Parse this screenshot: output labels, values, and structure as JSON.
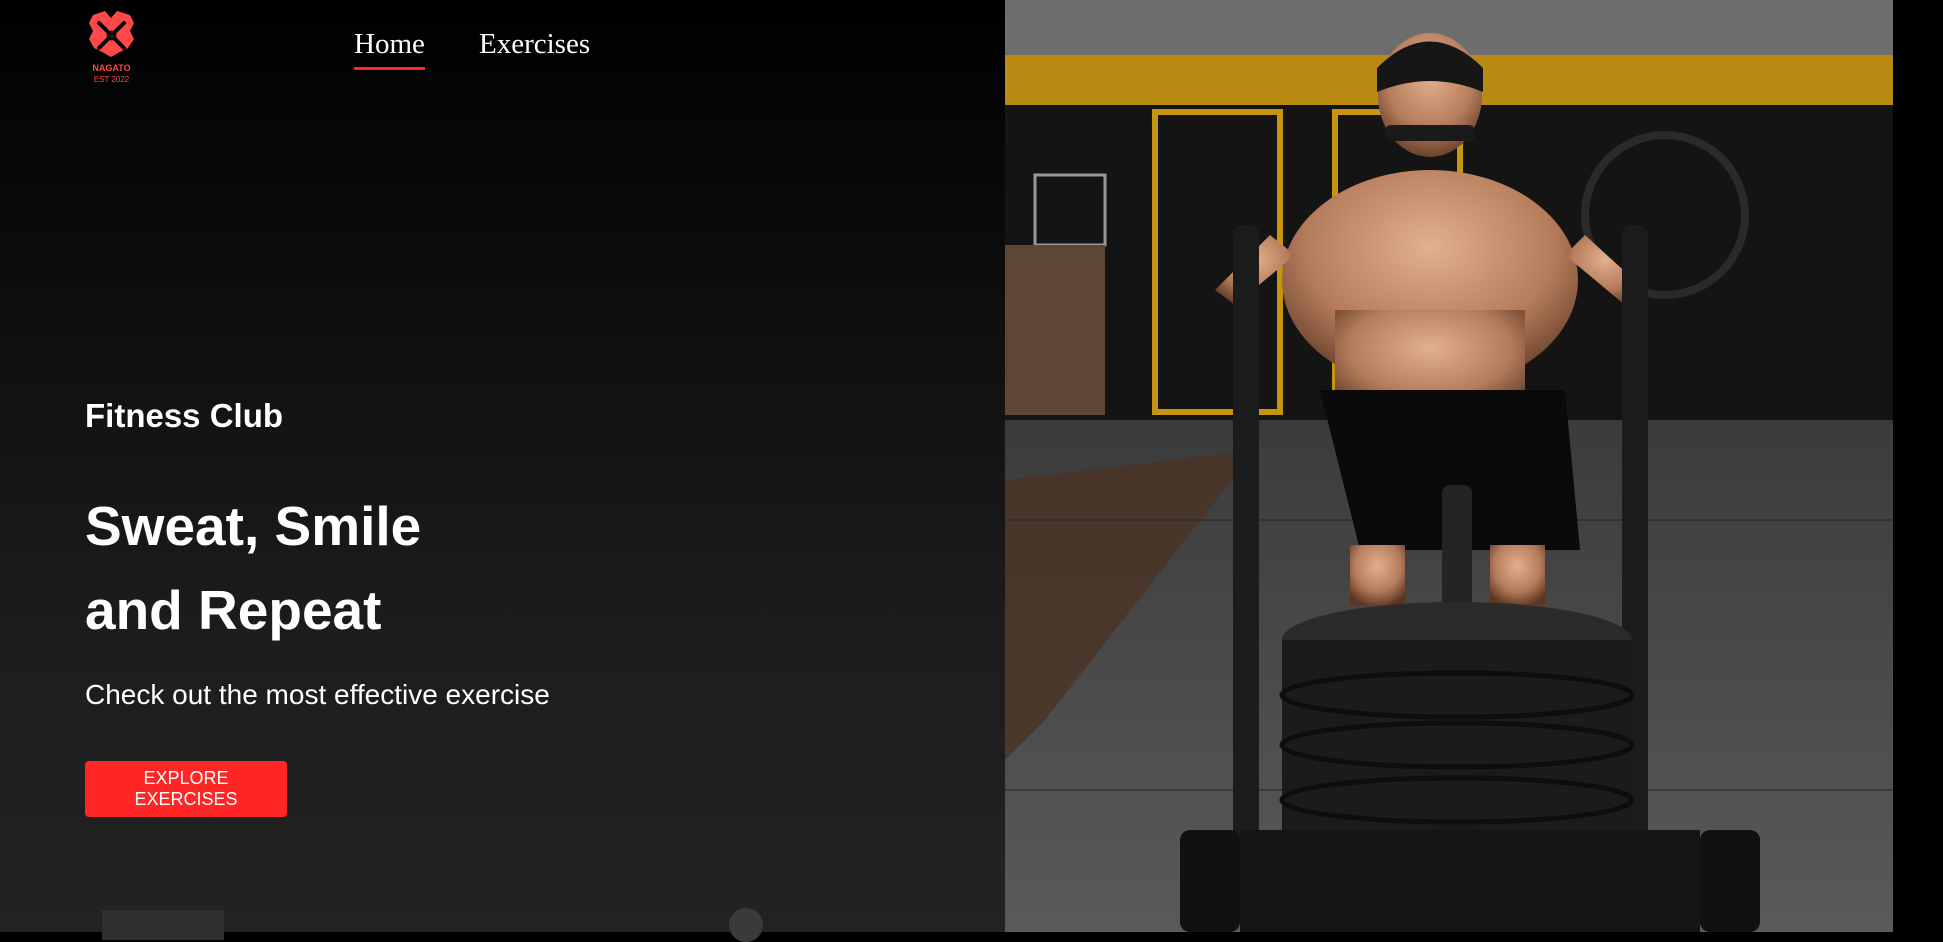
{
  "logo": {
    "name": "NAGATO",
    "tagline": "EST 2022"
  },
  "nav": {
    "items": [
      {
        "label": "Home",
        "active": true
      },
      {
        "label": "Exercises",
        "active": false
      }
    ]
  },
  "hero": {
    "eyebrow": "Fitness Club",
    "headline_line1": "Sweat, Smile",
    "headline_line2": "and Repeat",
    "subtitle": "Check out the most effective exercise",
    "cta_label": "EXPLORE EXERCISES",
    "image_alt": "man pushing weighted sled in gym"
  },
  "colors": {
    "accent": "#ff2625",
    "background": "#000000",
    "text": "#ffffff"
  }
}
